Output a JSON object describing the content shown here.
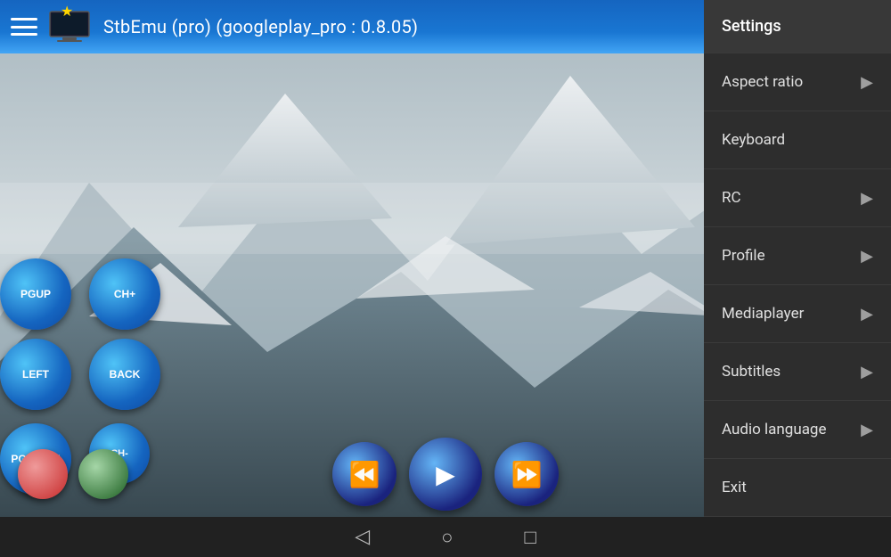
{
  "topbar": {
    "title": "StbEmu (pro) (googleplay_pro : 0.8.05)",
    "star": "★"
  },
  "controls": {
    "row1": [
      {
        "label": "PGUP"
      },
      {
        "label": "CH+"
      }
    ],
    "row2": [
      {
        "label": "LEFT"
      },
      {
        "label": "BACK"
      }
    ],
    "row3": [
      {
        "label": "PGDOWN"
      },
      {
        "label": "CH-"
      }
    ]
  },
  "menu": {
    "items": [
      {
        "id": "settings",
        "label": "Settings",
        "has_arrow": false
      },
      {
        "id": "aspect-ratio",
        "label": "Aspect ratio",
        "has_arrow": true
      },
      {
        "id": "keyboard",
        "label": "Keyboard",
        "has_arrow": false
      },
      {
        "id": "rc",
        "label": "RC",
        "has_arrow": true
      },
      {
        "id": "profile",
        "label": "Profile",
        "has_arrow": true
      },
      {
        "id": "mediaplayer",
        "label": "Mediaplayer",
        "has_arrow": true
      },
      {
        "id": "subtitles",
        "label": "Subtitles",
        "has_arrow": true
      },
      {
        "id": "audio-language",
        "label": "Audio language",
        "has_arrow": true
      },
      {
        "id": "exit",
        "label": "Exit",
        "has_arrow": false
      }
    ]
  },
  "navbar": {
    "back": "◁",
    "home": "○",
    "recents": "□"
  }
}
